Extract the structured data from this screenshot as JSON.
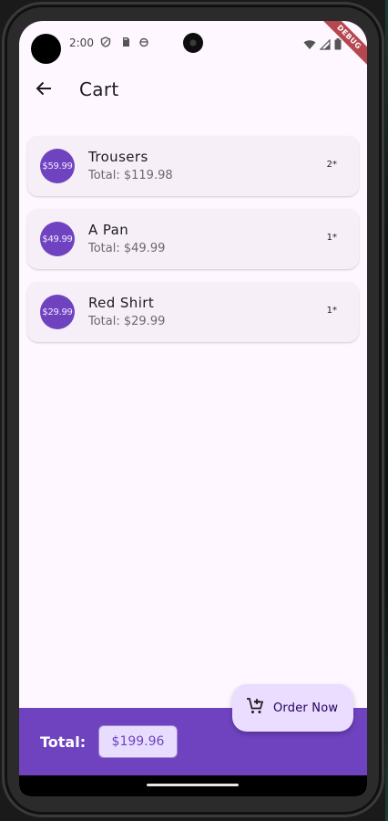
{
  "status_bar": {
    "time": "2:00",
    "icons_left": [
      "shield-icon",
      "sd-card-icon",
      "android-icon"
    ],
    "icons_right": [
      "wifi-icon",
      "signal-icon",
      "battery-icon"
    ],
    "debug_banner": "DEBUG"
  },
  "app_bar": {
    "title": "Cart"
  },
  "cart": {
    "items": [
      {
        "price": "$59.99",
        "name": "Trousers",
        "total": "Total: $119.98",
        "qty": "2*"
      },
      {
        "price": "$49.99",
        "name": "A Pan",
        "total": "Total: $49.99",
        "qty": "1*"
      },
      {
        "price": "$29.99",
        "name": "Red Shirt",
        "total": "Total: $29.99",
        "qty": "1*"
      }
    ]
  },
  "footer": {
    "total_label": "Total:",
    "total_value": "$199.96",
    "order_button": "Order Now"
  },
  "colors": {
    "primary": "#6f43c0",
    "surface": "#fef7ff",
    "card": "#f6eff8",
    "fab": "#eaddff"
  }
}
